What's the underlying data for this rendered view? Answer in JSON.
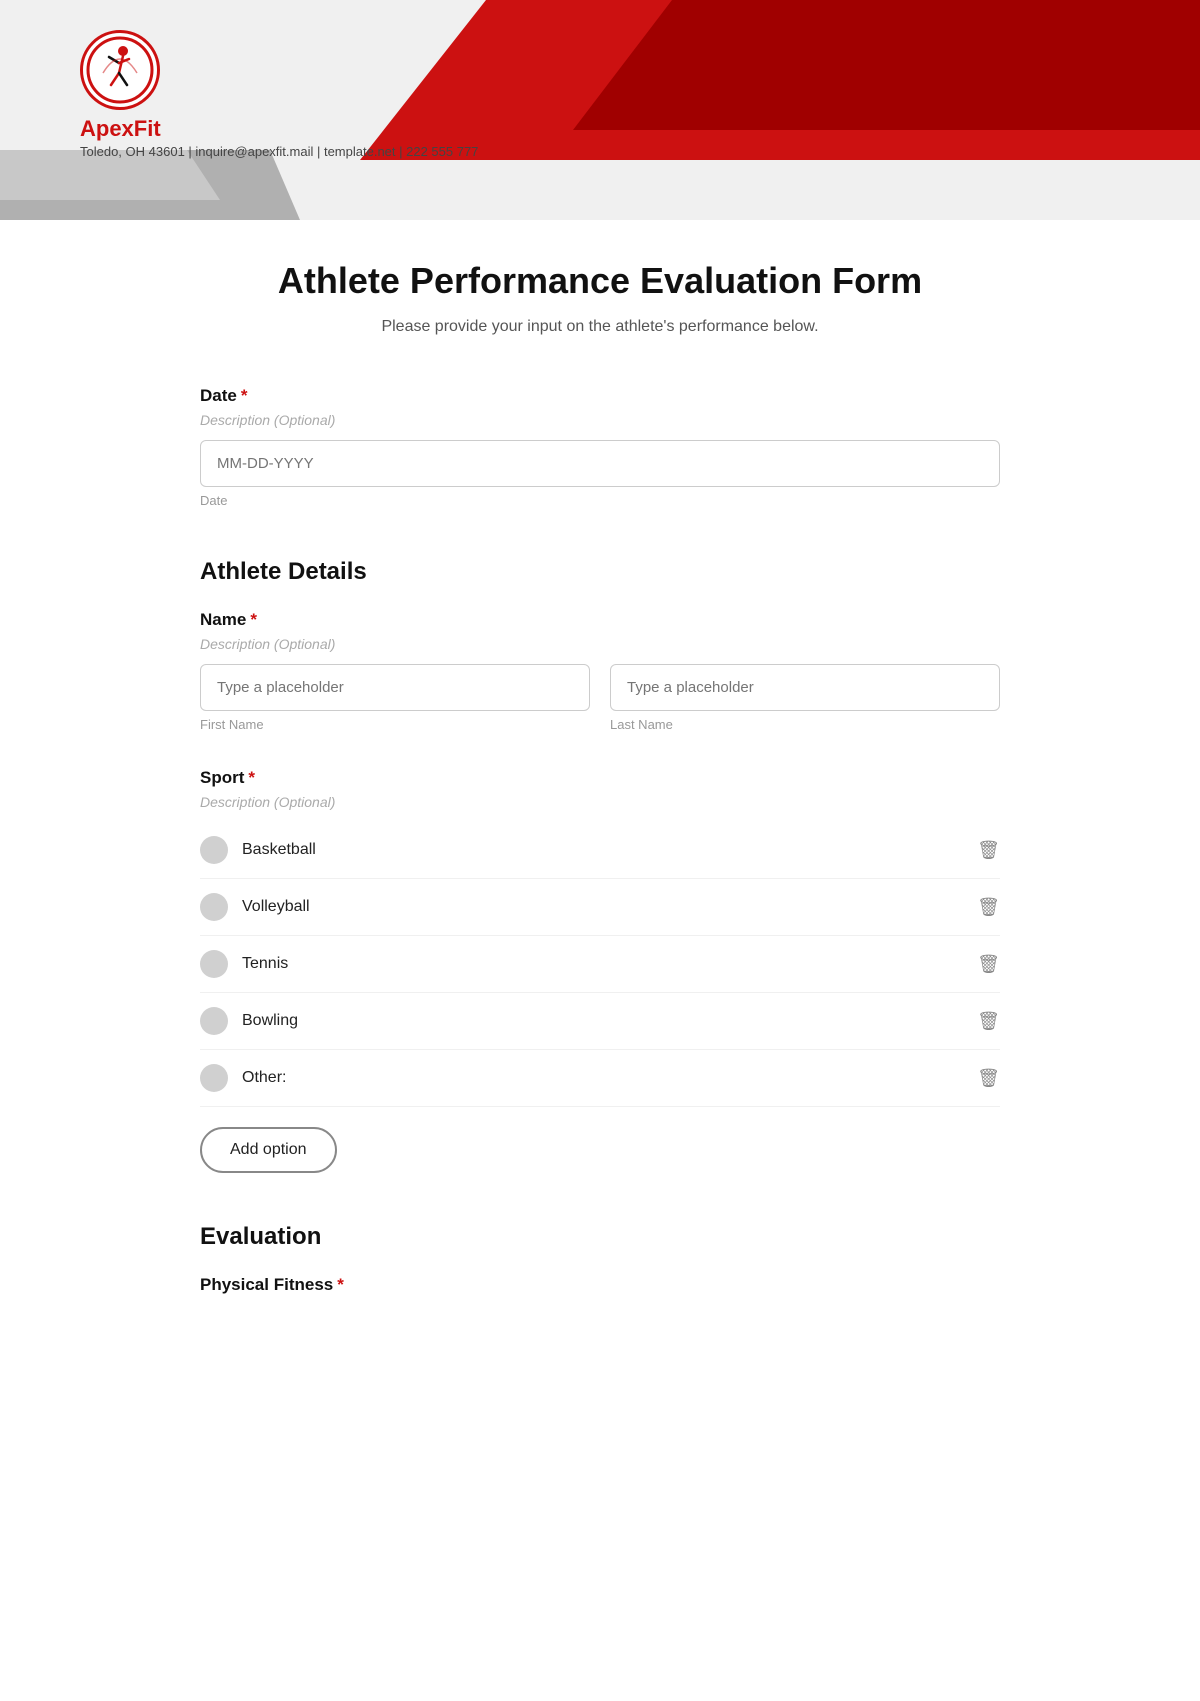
{
  "header": {
    "logo_name": "ApexFit",
    "contact_info": "Toledo, OH 43601 | inquire@apexfit.mail | template.net | 222 555 777"
  },
  "form": {
    "title": "Athlete Performance Evaluation Form",
    "subtitle": "Please provide your input on the athlete's performance below.",
    "sections": {
      "date": {
        "label": "Date",
        "required": true,
        "description": "Description (Optional)",
        "placeholder": "MM-DD-YYYY",
        "hint": "Date"
      },
      "athlete_details": {
        "section_title": "Athlete Details",
        "name": {
          "label": "Name",
          "required": true,
          "description": "Description (Optional)",
          "first_placeholder": "Type a placeholder",
          "last_placeholder": "Type a placeholder",
          "first_hint": "First Name",
          "last_hint": "Last Name"
        },
        "sport": {
          "label": "Sport",
          "required": true,
          "description": "Description (Optional)",
          "options": [
            {
              "id": "basketball",
              "label": "Basketball"
            },
            {
              "id": "volleyball",
              "label": "Volleyball"
            },
            {
              "id": "tennis",
              "label": "Tennis"
            },
            {
              "id": "bowling",
              "label": "Bowling"
            },
            {
              "id": "other",
              "label": "Other:"
            }
          ],
          "add_option_label": "Add option"
        }
      },
      "evaluation": {
        "section_title": "Evaluation",
        "physical_fitness": {
          "label": "Physical Fitness",
          "required": true
        }
      }
    }
  },
  "icons": {
    "delete": "🗑",
    "add": "+"
  }
}
